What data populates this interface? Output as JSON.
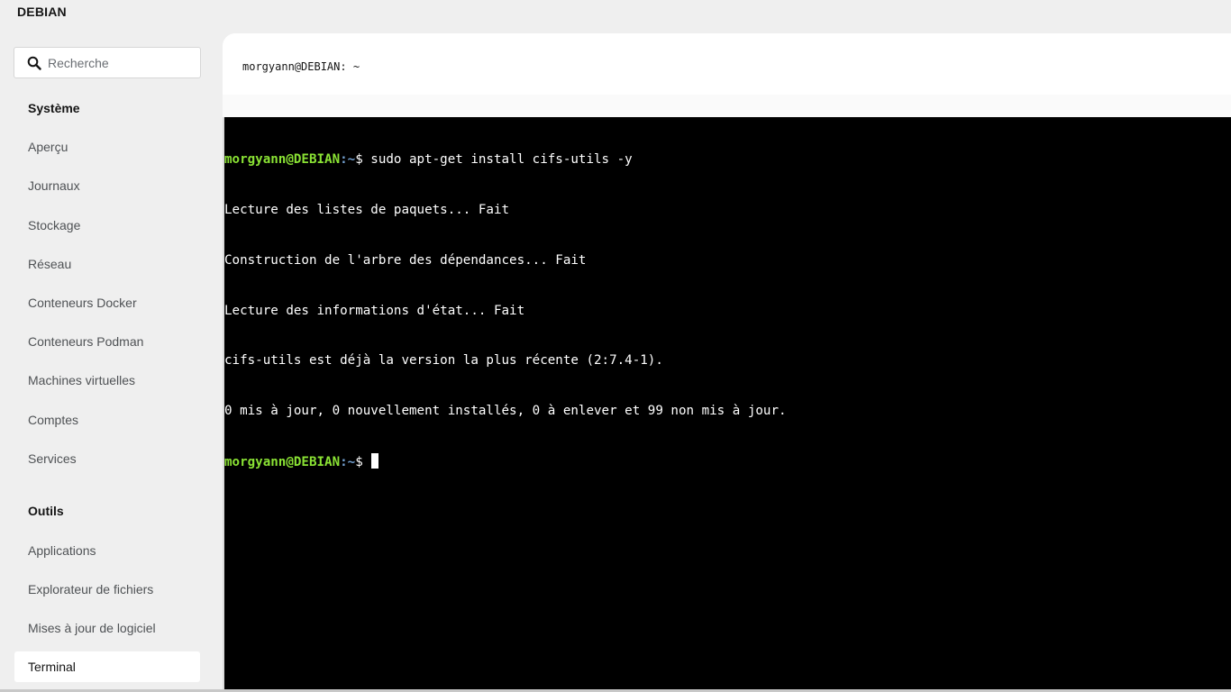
{
  "app": {
    "hostname": "DEBIAN"
  },
  "search": {
    "placeholder": "Recherche"
  },
  "sidebar": {
    "sections": [
      {
        "title": "Système"
      },
      {
        "title": "Outils"
      }
    ],
    "system_items": [
      {
        "label": "Aperçu"
      },
      {
        "label": "Journaux"
      },
      {
        "label": "Stockage"
      },
      {
        "label": "Réseau"
      },
      {
        "label": "Conteneurs Docker"
      },
      {
        "label": "Conteneurs Podman"
      },
      {
        "label": "Machines virtuelles"
      },
      {
        "label": "Comptes"
      },
      {
        "label": "Services"
      }
    ],
    "tools_items": [
      {
        "label": "Applications"
      },
      {
        "label": "Explorateur de fichiers"
      },
      {
        "label": "Mises à jour de logiciel"
      },
      {
        "label": "Terminal",
        "active": true
      }
    ]
  },
  "terminal": {
    "title": "morgyann@DEBIAN: ~",
    "prompt_user": "morgyann@DEBIAN",
    "prompt_path": ":~",
    "prompt_symbol": "$",
    "command": " sudo apt-get install cifs-utils -y",
    "output": [
      "Lecture des listes de paquets... Fait",
      "Construction de l'arbre des dépendances... Fait",
      "Lecture des informations d'état... Fait",
      "cifs-utils est déjà la version la plus récente (2:7.4-1).",
      "0 mis à jour, 0 nouvellement installés, 0 à enlever et 99 non mis à jour."
    ],
    "colors": {
      "background": "#000000",
      "user": "#8ae234",
      "path": "#729fcf",
      "text": "#ffffff"
    }
  },
  "icons": {
    "search": "search-icon"
  }
}
